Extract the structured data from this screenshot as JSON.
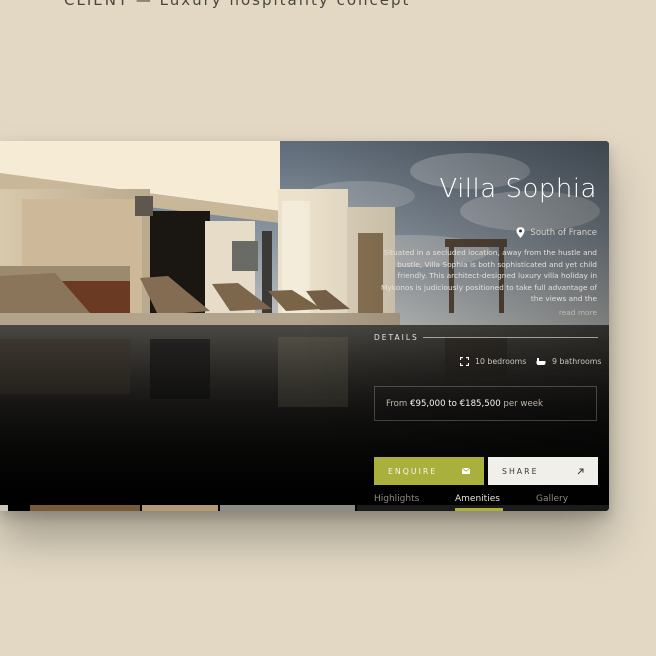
{
  "caption": "CLIENT — Luxury hospitality concept",
  "property": {
    "name": "Villa Sophia",
    "location": "South of France",
    "description": "Situated in a secluded location, away from the hustle and bustle, Villa Sophia is both sophisticated and yet child friendly. This architect-designed luxury villa holiday in Mykonos is judiciously positioned to take full advantage of the views and the",
    "read_more": "read more"
  },
  "details": {
    "label": "DETAILS",
    "bedrooms": "10 bedrooms",
    "bathrooms": "9 bathrooms"
  },
  "price": {
    "prefix": "From",
    "range": "€95,000 to €185,500",
    "suffix": "per week"
  },
  "actions": {
    "enquire": "ENQUIRE",
    "share": "SHARE"
  },
  "tabs": [
    {
      "label": "Highlights",
      "active": false
    },
    {
      "label": "Amenities",
      "active": true
    },
    {
      "label": "Gallery",
      "active": false
    }
  ],
  "icons": {
    "location": "map-pin-icon",
    "bedrooms": "bed-expand-icon",
    "bathrooms": "bath-icon",
    "enquire": "envelope-icon",
    "share": "arrow-up-right-icon"
  },
  "colors": {
    "page_background": "#e2d8c4",
    "accent": "#aab03c",
    "card_dark": "#050505"
  }
}
